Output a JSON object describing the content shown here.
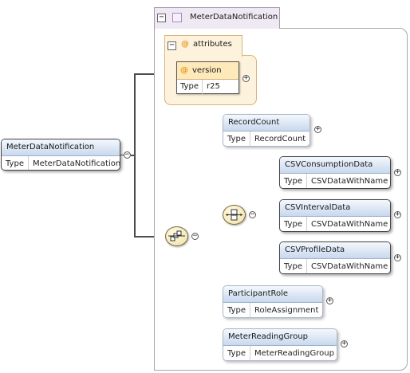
{
  "root": {
    "name": "MeterDataNotification",
    "type_key": "Type",
    "type_value": "MeterDataNotification"
  },
  "complex_type": {
    "name": "MeterDataNotification"
  },
  "attributes_group": {
    "label": "attributes",
    "symbol": "@"
  },
  "attribute": {
    "name": "version",
    "symbol": "@",
    "type_key": "Type",
    "type_value": "r25"
  },
  "elements": {
    "record_count": {
      "name": "RecordCount",
      "type_key": "Type",
      "type_value": "RecordCount"
    },
    "csv_consumption": {
      "name": "CSVConsumptionData",
      "type_key": "Type",
      "type_value": "CSVDataWithName"
    },
    "csv_interval": {
      "name": "CSVIntervalData",
      "type_key": "Type",
      "type_value": "CSVDataWithName"
    },
    "csv_profile": {
      "name": "CSVProfileData",
      "type_key": "Type",
      "type_value": "CSVDataWithName"
    },
    "participant_role": {
      "name": "ParticipantRole",
      "type_key": "Type",
      "type_value": "RoleAssignment"
    },
    "meter_reading_group": {
      "name": "MeterReadingGroup",
      "type_key": "Type",
      "type_value": "MeterReadingGroup"
    }
  },
  "toggles": {
    "collapse": "−",
    "expand": "+"
  },
  "colors": {
    "element_header": "#c8d8ee",
    "attribute_header": "#fde9b9",
    "complex_type_tab": "#efe9f4",
    "compositor": "#efe0a6"
  }
}
